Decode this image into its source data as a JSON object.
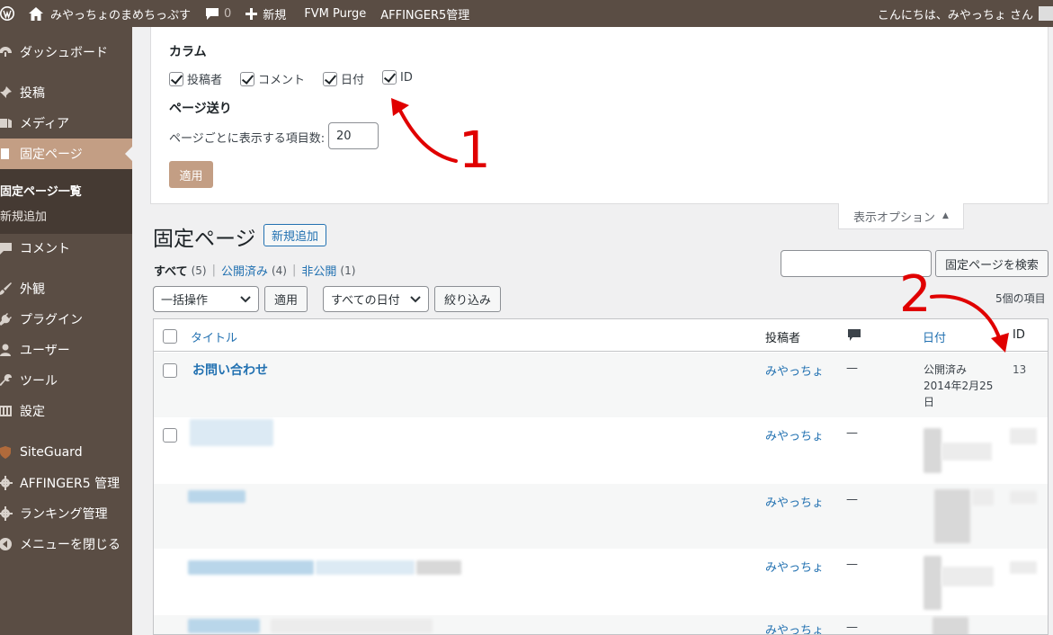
{
  "adminbar": {
    "site_name": "みやっちょのまめちっぷす",
    "comments_count": "0",
    "new_label": "新規",
    "fvm_label": "FVM Purge",
    "affinger_label": "AFFINGER5管理",
    "greeting": "こんにちは、みやっちょ さん"
  },
  "sidebar": {
    "items": [
      {
        "label": "ダッシュボード",
        "icon": "dashboard-icon"
      },
      {
        "label": "投稿",
        "icon": "pin-icon"
      },
      {
        "label": "メディア",
        "icon": "media-icon"
      },
      {
        "label": "固定ページ",
        "icon": "page-icon"
      },
      {
        "label": "コメント",
        "icon": "comment-icon"
      },
      {
        "label": "外観",
        "icon": "brush-icon"
      },
      {
        "label": "プラグイン",
        "icon": "plugin-icon"
      },
      {
        "label": "ユーザー",
        "icon": "user-icon"
      },
      {
        "label": "ツール",
        "icon": "wrench-icon"
      },
      {
        "label": "設定",
        "icon": "settings-icon"
      },
      {
        "label": "SiteGuard",
        "icon": "siteguard-icon"
      },
      {
        "label": "AFFINGER5 管理",
        "icon": "gear-icon"
      },
      {
        "label": "ランキング管理",
        "icon": "gear-icon"
      },
      {
        "label": "メニューを閉じる",
        "icon": "collapse-icon"
      }
    ],
    "submenu": [
      "固定ページ一覧",
      "新規追加"
    ]
  },
  "screen_options": {
    "columns_heading": "カラム",
    "columns": [
      "投稿者",
      "コメント",
      "日付",
      "ID"
    ],
    "pagination_heading": "ページ送り",
    "per_page_label": "ページごとに表示する項目数:",
    "per_page_value": "20",
    "apply_label": "適用",
    "tab_label": "表示オプション"
  },
  "page": {
    "title": "固定ページ",
    "add_new": "新規追加",
    "filters": {
      "all": "すべて",
      "all_count": "(5)",
      "published": "公開済み",
      "published_count": "(4)",
      "private": "非公開",
      "private_count": "(1)"
    },
    "search_button": "固定ページを検索",
    "bulk_action": "一括操作",
    "apply": "適用",
    "all_dates": "すべての日付",
    "filter_button": "絞り込み",
    "items_count": "5個の項目"
  },
  "table": {
    "headers": {
      "title": "タイトル",
      "author": "投稿者",
      "date": "日付",
      "id": "ID"
    },
    "rows": [
      {
        "title": "お問い合わせ",
        "author": "みやっちょ",
        "comments": "—",
        "date": "公開済み 2014年2月25日",
        "id": "13"
      },
      {
        "title": "",
        "author": "みやっちょ",
        "comments": "—",
        "date": "",
        "id": ""
      },
      {
        "title": "",
        "author": "みやっちょ",
        "comments": "—",
        "date": "",
        "id": ""
      },
      {
        "title": "",
        "author": "みやっちょ",
        "comments": "—",
        "date": "",
        "id": ""
      },
      {
        "title": "",
        "author": "みやっちょ",
        "comments": "—",
        "date": "",
        "id": ""
      }
    ]
  },
  "annotations": {
    "one": "1",
    "two": "2",
    "color": "#e00000"
  },
  "colors": {
    "adminbar": "#5a4d44",
    "accent": "#c39e84",
    "link": "#2271b1"
  }
}
